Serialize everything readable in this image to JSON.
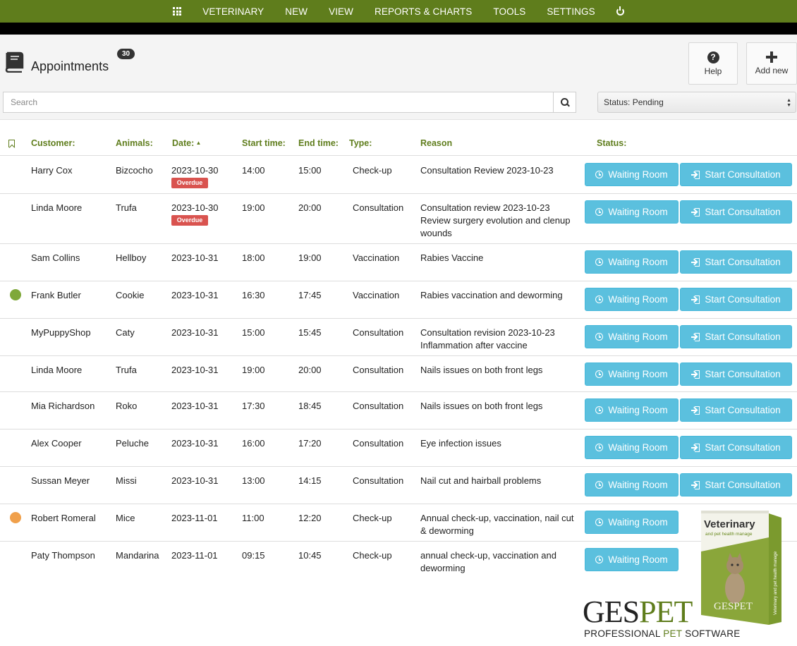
{
  "nav": {
    "items": [
      {
        "label": "VETERINARY"
      },
      {
        "label": "NEW"
      },
      {
        "label": "VIEW"
      },
      {
        "label": "REPORTS & CHARTS"
      },
      {
        "label": "TOOLS"
      },
      {
        "label": "SETTINGS"
      }
    ],
    "apps_icon": "grid-icon",
    "logout_icon": "power-icon",
    "bg_color": "#5f7d1c"
  },
  "header": {
    "title": "Appointments",
    "count": "30",
    "help_label": "Help",
    "add_label": "Add new"
  },
  "search": {
    "placeholder": "Search",
    "value": ""
  },
  "status_filter": {
    "label": "Status:",
    "value": "Pending"
  },
  "table": {
    "columns": {
      "customer": "Customer:",
      "animals": "Animals:",
      "date": "Date:",
      "start": "Start time:",
      "end": "End time:",
      "type": "Type:",
      "reason": "Reason",
      "status": "Status:"
    },
    "waiting_label": "Waiting Room",
    "start_label": "Start Consultation",
    "overdue_label": "Overdue",
    "rows": [
      {
        "customer": "Harry Cox",
        "animal": "Bizcocho",
        "date": "2023-10-30",
        "overdue": true,
        "start": "14:00",
        "end": "15:00",
        "type": "Check-up",
        "reason": "Consultation Review 2023-10-23",
        "dot": ""
      },
      {
        "customer": "Linda Moore",
        "animal": "Trufa",
        "date": "2023-10-30",
        "overdue": true,
        "start": "19:00",
        "end": "20:00",
        "type": "Consultation",
        "reason": "Consultation review 2023-10-23 Review surgery evolution and clenup  wounds",
        "dot": ""
      },
      {
        "customer": "Sam Collins",
        "animal": "Hellboy",
        "date": "2023-10-31",
        "overdue": false,
        "start": "18:00",
        "end": "19:00",
        "type": "Vaccination",
        "reason": "Rabies Vaccine",
        "dot": ""
      },
      {
        "customer": "Frank Butler",
        "animal": "Cookie",
        "date": "2023-10-31",
        "overdue": false,
        "start": "16:30",
        "end": "17:45",
        "type": "Vaccination",
        "reason": "Rabies vaccination and deworming",
        "dot": "#7fa83a"
      },
      {
        "customer": "MyPuppyShop",
        "animal": "Caty",
        "date": "2023-10-31",
        "overdue": false,
        "start": "15:00",
        "end": "15:45",
        "type": "Consultation",
        "reason": "Consultation revision 2023-10-23 Inflammation after vaccine",
        "dot": ""
      },
      {
        "customer": "Linda Moore",
        "animal": "Trufa",
        "date": "2023-10-31",
        "overdue": false,
        "start": "19:00",
        "end": "20:00",
        "type": "Consultation",
        "reason": "Nails issues on both front legs",
        "dot": ""
      },
      {
        "customer": "Mia Richardson",
        "animal": "Roko",
        "date": "2023-10-31",
        "overdue": false,
        "start": "17:30",
        "end": "18:45",
        "type": "Consultation",
        "reason": "Nails issues on both front legs",
        "dot": ""
      },
      {
        "customer": "Alex Cooper",
        "animal": "Peluche",
        "date": "2023-10-31",
        "overdue": false,
        "start": "16:00",
        "end": "17:20",
        "type": "Consultation",
        "reason": "Eye infection issues",
        "dot": ""
      },
      {
        "customer": "Sussan Meyer",
        "animal": "Missi",
        "date": "2023-10-31",
        "overdue": false,
        "start": "13:00",
        "end": "14:15",
        "type": "Consultation",
        "reason": "Nail cut and hairball problems",
        "dot": ""
      },
      {
        "customer": "Robert Romeral",
        "animal": "Mice",
        "date": "2023-11-01",
        "overdue": false,
        "start": "11:00",
        "end": "12:20",
        "type": "Check-up",
        "reason": "Annual check-up, vaccination, nail cut & deworming",
        "dot": "#f0a04b"
      },
      {
        "customer": "Paty Thompson",
        "animal": "Mandarina",
        "date": "2023-11-01",
        "overdue": false,
        "start": "09:15",
        "end": "10:45",
        "type": "Check-up",
        "reason": "annual check-up, vaccination and deworming",
        "dot": ""
      }
    ]
  },
  "promo": {
    "box_title": "Veterinary",
    "box_subtitle": "and pet health manage",
    "box_brand": "GESPET",
    "box_side": "Veterinary and pet health manage",
    "logo_ges": "GES",
    "logo_pet": "PET",
    "tag_a": "PROFESSIONAL ",
    "tag_b": "PET",
    "tag_c": " SOFTWARE"
  },
  "colors": {
    "accent": "#5f7d1c",
    "button_info": "#5bc0de",
    "overdue": "#d9534f"
  }
}
